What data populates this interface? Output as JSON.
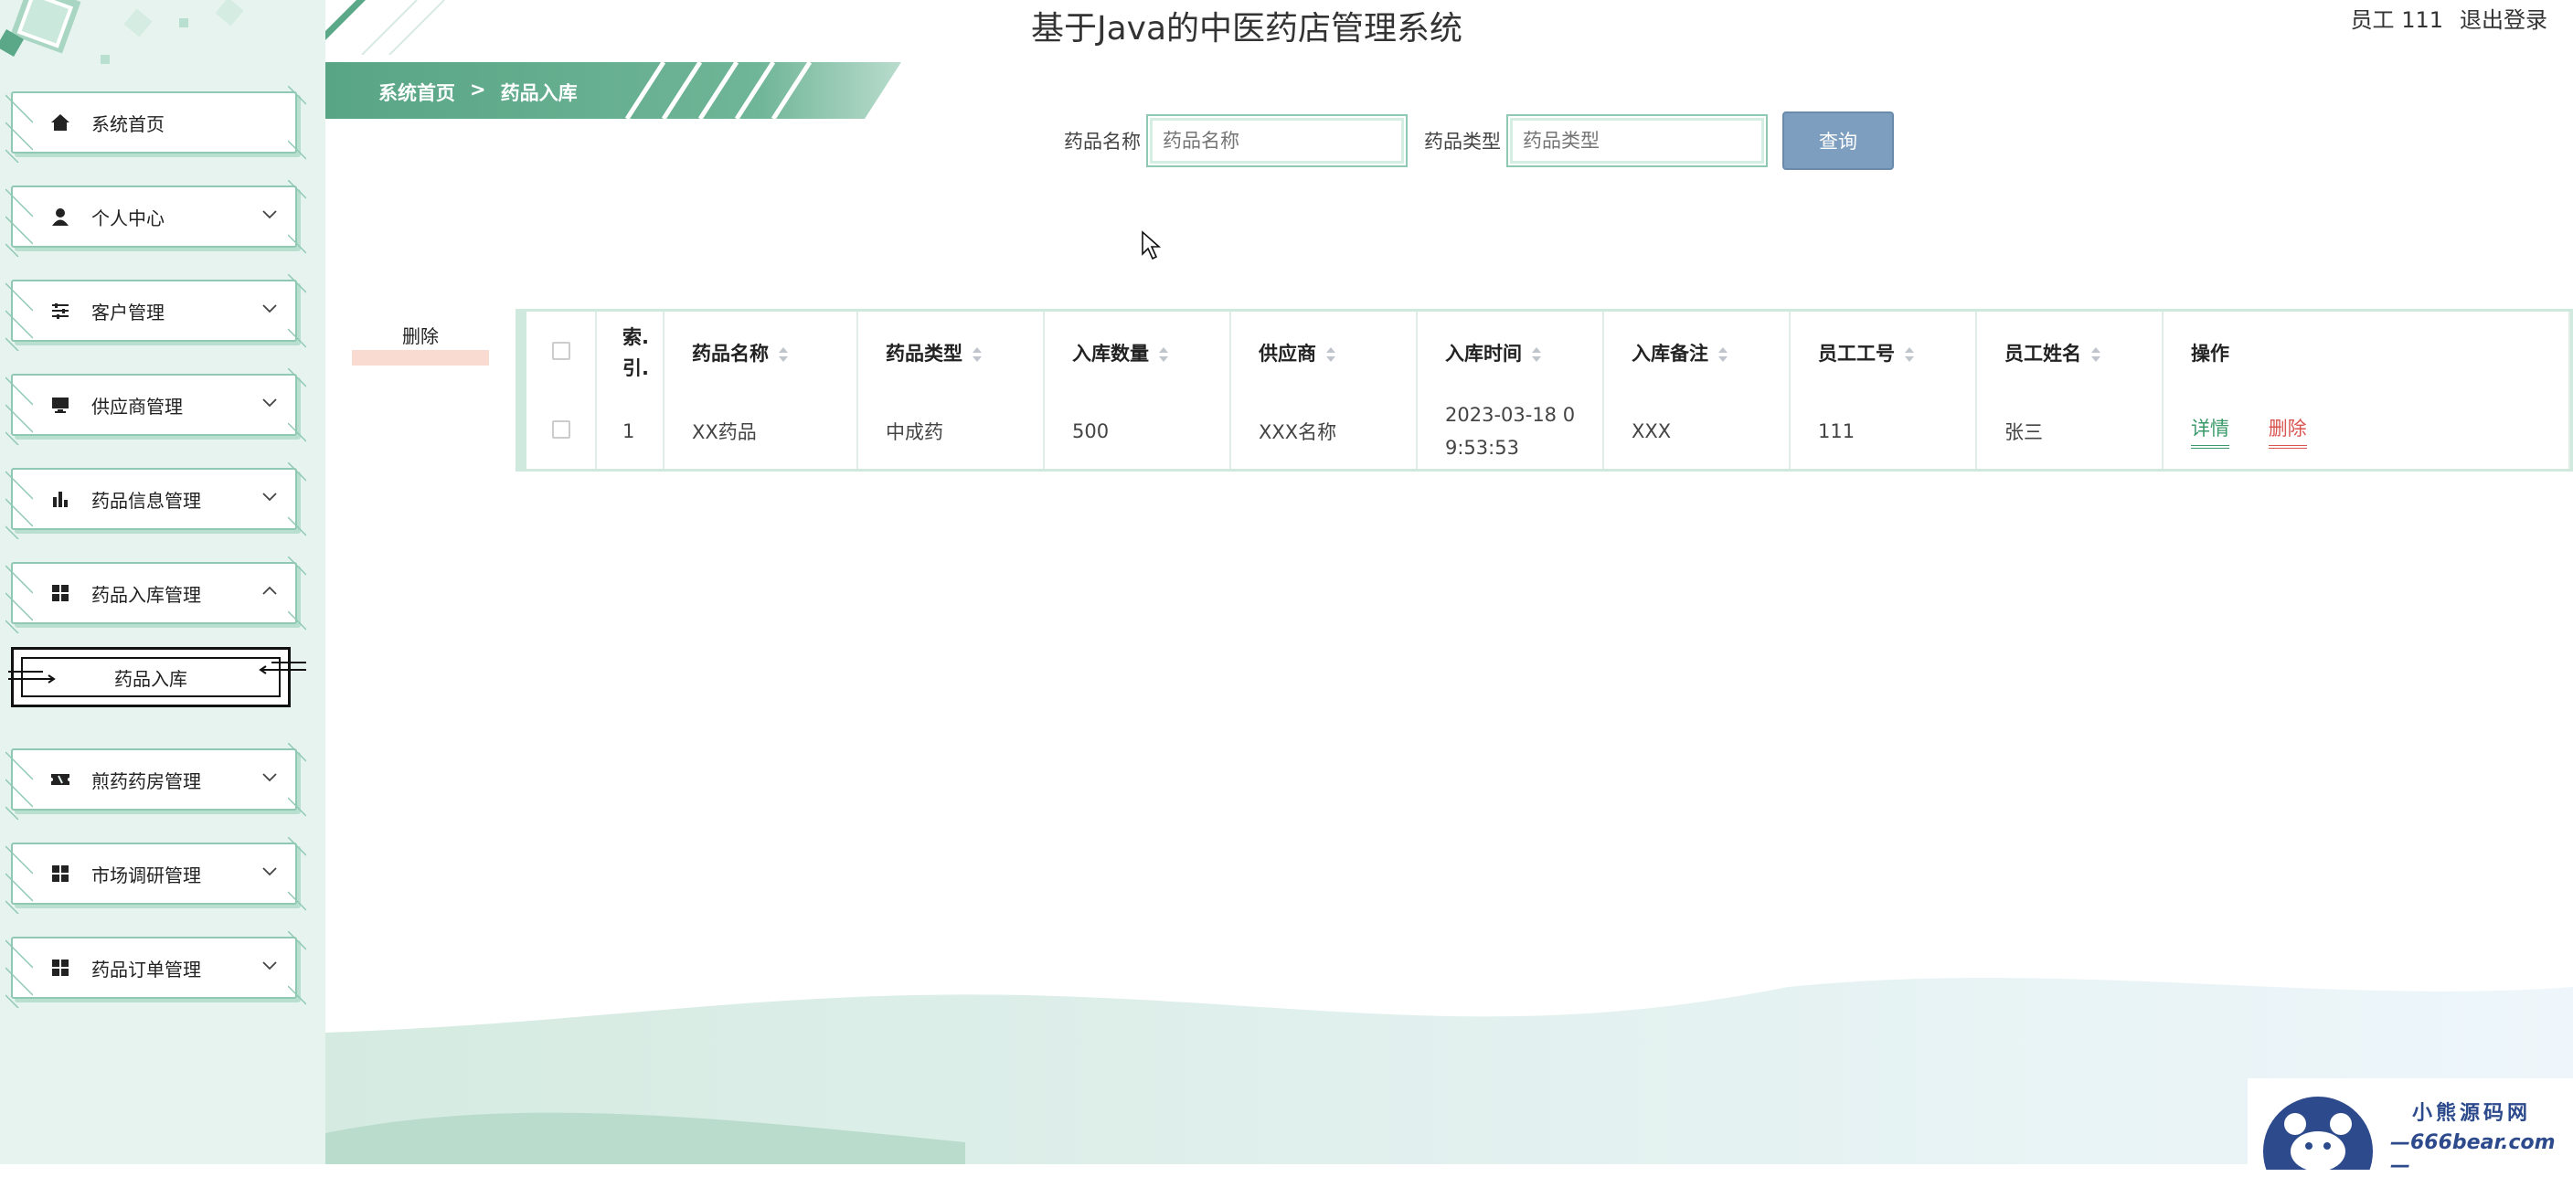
{
  "app": {
    "title": "基于Java的中医药店管理系统",
    "user_label": "员工 111",
    "logout_label": "退出登录"
  },
  "breadcrumb": {
    "home": "系统首页",
    "sep": ">",
    "current": "药品入库"
  },
  "sidebar": {
    "items": [
      {
        "label": "系统首页",
        "icon": "home-icon"
      },
      {
        "label": "个人中心",
        "icon": "user-icon"
      },
      {
        "label": "客户管理",
        "icon": "sliders-icon"
      },
      {
        "label": "供应商管理",
        "icon": "monitor-icon"
      },
      {
        "label": "药品信息管理",
        "icon": "bar-chart-icon"
      },
      {
        "label": "药品入库管理",
        "icon": "grid-icon"
      },
      {
        "label": "煎药药房管理",
        "icon": "ticket-icon"
      },
      {
        "label": "市场调研管理",
        "icon": "grid-icon"
      },
      {
        "label": "药品订单管理",
        "icon": "grid-icon"
      }
    ],
    "sub_item": "药品入库"
  },
  "search": {
    "name_label": "药品名称",
    "name_placeholder": "药品名称",
    "type_label": "药品类型",
    "type_placeholder": "药品类型",
    "query_button": "查询"
  },
  "actions": {
    "delete_label": "删除"
  },
  "table": {
    "headers": {
      "index": "索.引.",
      "name": "药品名称",
      "type": "药品类型",
      "qty": "入库数量",
      "supplier": "供应商",
      "time": "入库时间",
      "remark": "入库备注",
      "emp_no": "员工工号",
      "emp_name": "员工姓名",
      "op": "操作"
    },
    "rows": [
      {
        "index": "1",
        "name": "XX药品",
        "type": "中成药",
        "qty": "500",
        "supplier": "XXX名称",
        "time": "2023-03-18 09:53:53",
        "remark": "XXX",
        "emp_no": "111",
        "emp_name": "张三",
        "detail": "详情",
        "remove": "删除"
      }
    ]
  },
  "watermark": {
    "line1": "小熊源码网",
    "line2": "—666bear.com—"
  },
  "colors": {
    "accent": "#5aa888",
    "sidebar_bg": "#e6f3ee",
    "query_button": "#7d9ebf",
    "delete_red": "#d9534f"
  }
}
